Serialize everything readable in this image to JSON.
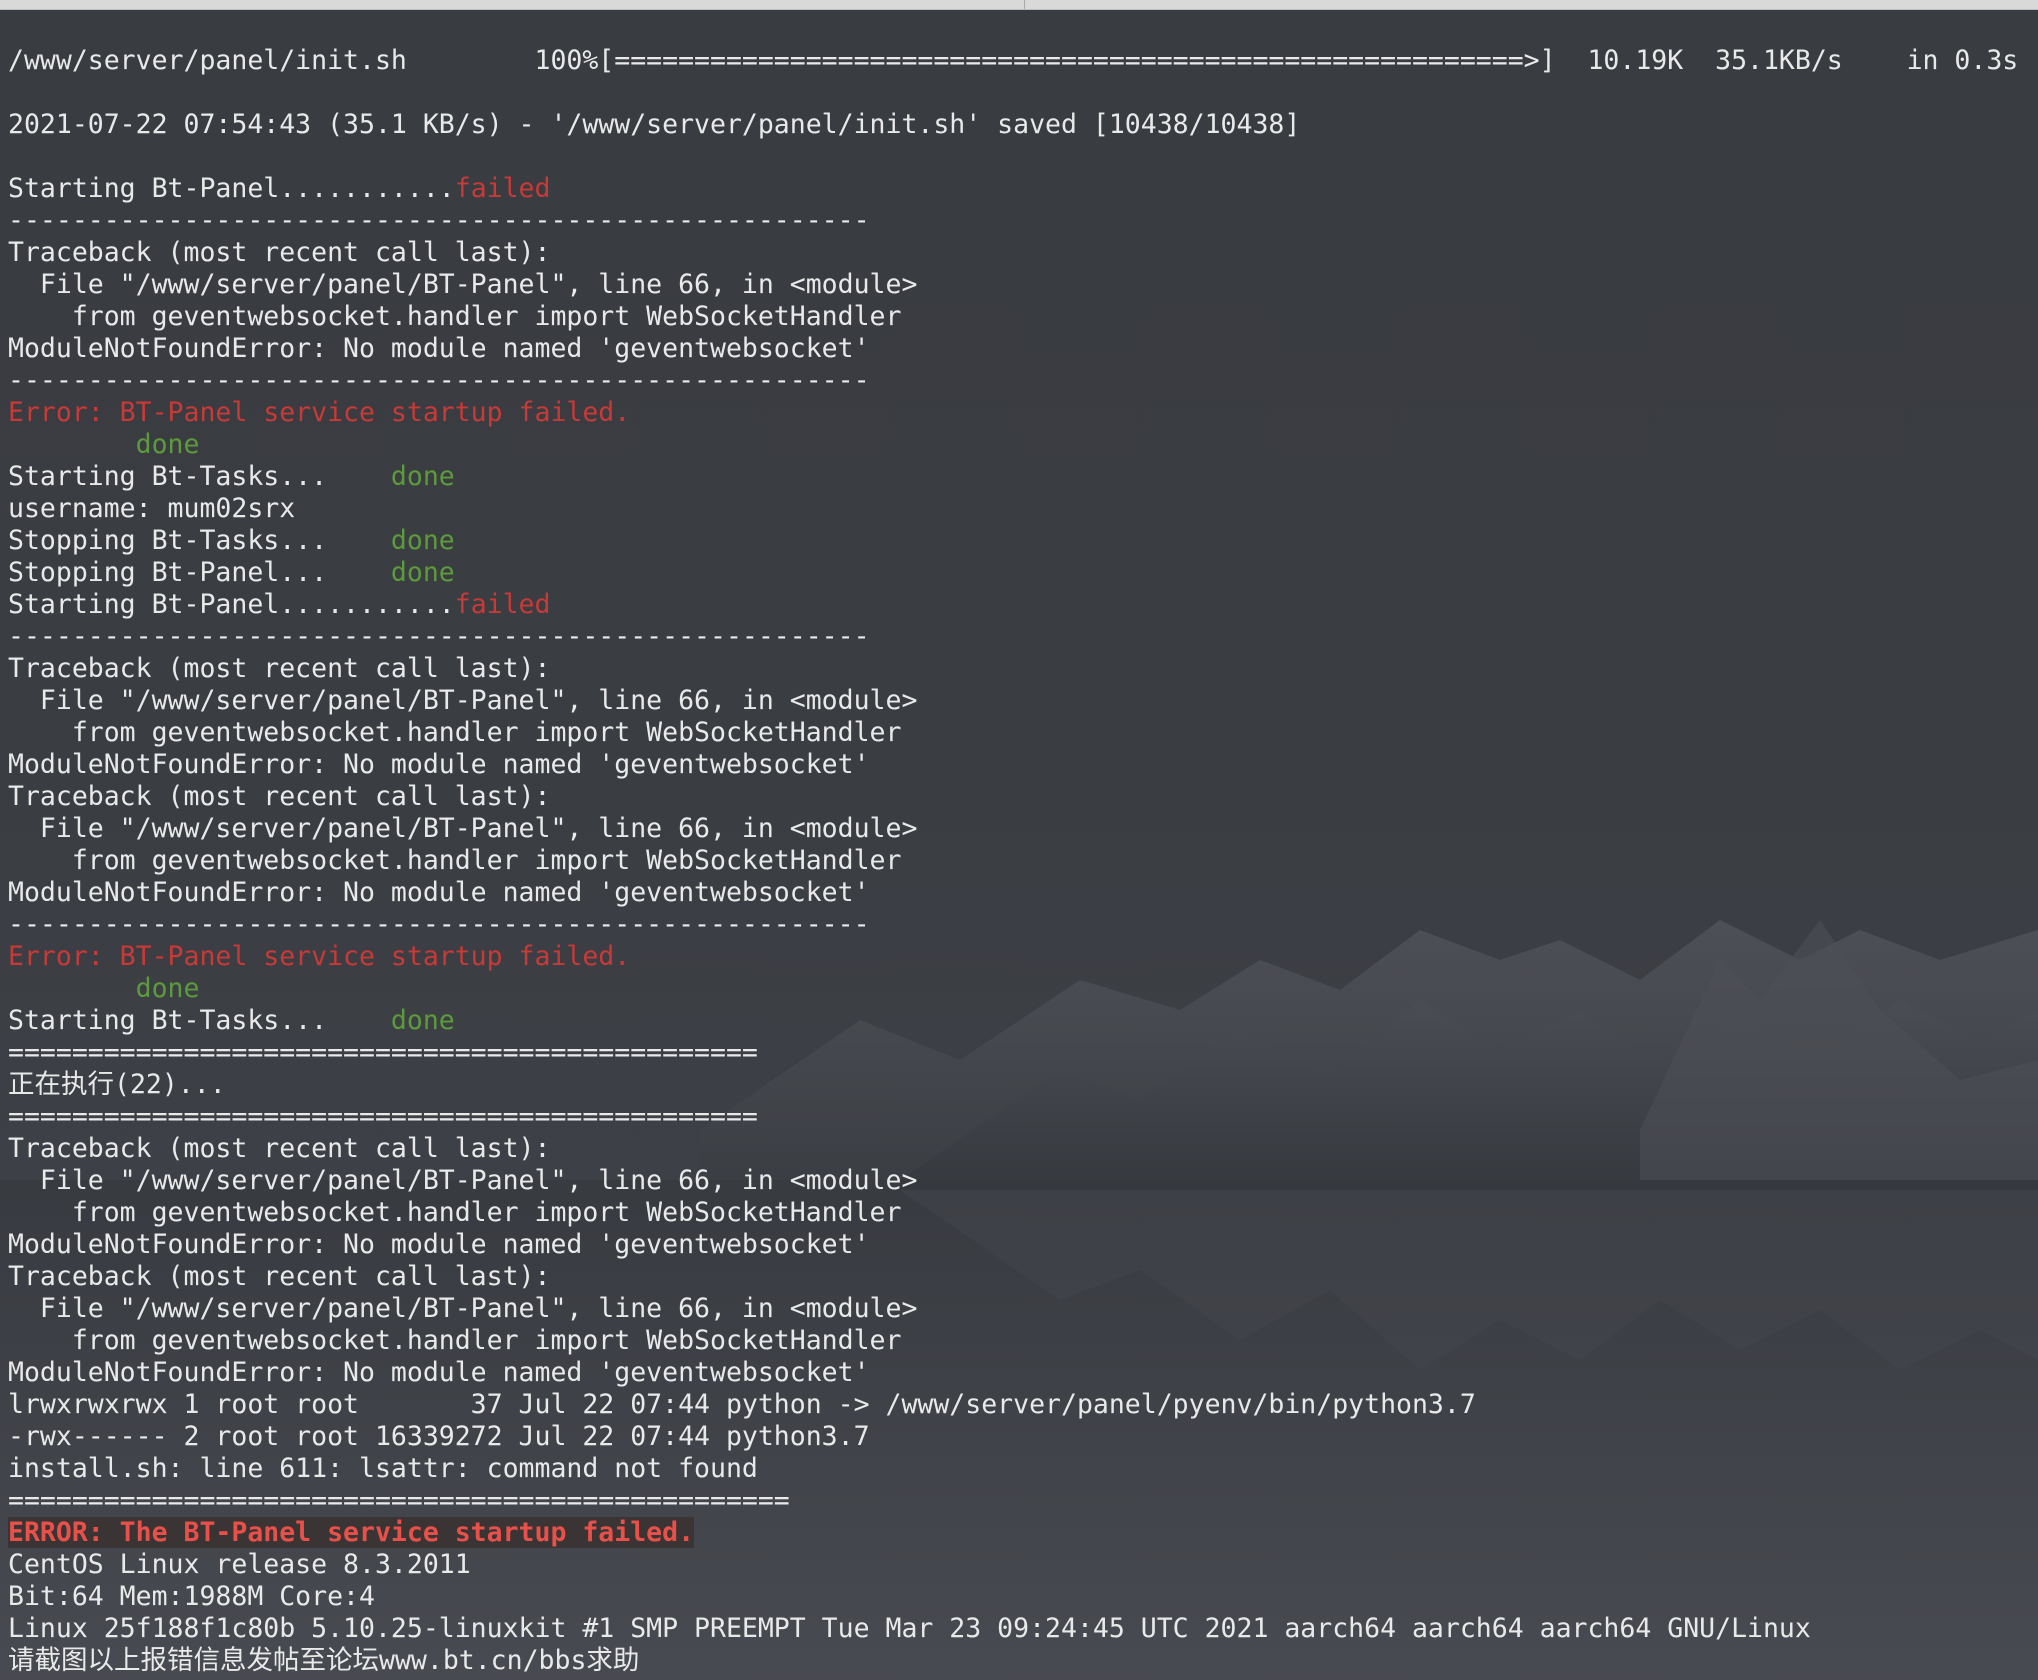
{
  "terminal": {
    "lines": [
      {
        "text": "/www/server/panel/init.sh        100%[=========================================================>]  10.19K  35.1KB/s    in 0.3s"
      },
      {
        "text": ""
      },
      {
        "text": "2021-07-22 07:54:43 (35.1 KB/s) - '/www/server/panel/init.sh' saved [10438/10438]"
      },
      {
        "text": ""
      },
      {
        "text": "Starting Bt-Panel...........",
        "suffix": "failed",
        "suffix_color": "red"
      },
      {
        "text": "------------------------------------------------------"
      },
      {
        "text": "Traceback (most recent call last):"
      },
      {
        "text": "  File \"/www/server/panel/BT-Panel\", line 66, in <module>"
      },
      {
        "text": "    from geventwebsocket.handler import WebSocketHandler"
      },
      {
        "text": "ModuleNotFoundError: No module named 'geventwebsocket'"
      },
      {
        "text": "------------------------------------------------------"
      },
      {
        "text": "Error: BT-Panel service startup failed.",
        "color": "red"
      },
      {
        "text": "        ",
        "suffix": "done",
        "suffix_color": "green"
      },
      {
        "text": "Starting Bt-Tasks...    ",
        "suffix": "done",
        "suffix_color": "green"
      },
      {
        "text": "username: mum02srx"
      },
      {
        "text": "Stopping Bt-Tasks...    ",
        "suffix": "done",
        "suffix_color": "green"
      },
      {
        "text": "Stopping Bt-Panel...    ",
        "suffix": "done",
        "suffix_color": "green"
      },
      {
        "text": "Starting Bt-Panel...........",
        "suffix": "failed",
        "suffix_color": "red"
      },
      {
        "text": "------------------------------------------------------"
      },
      {
        "text": "Traceback (most recent call last):"
      },
      {
        "text": "  File \"/www/server/panel/BT-Panel\", line 66, in <module>"
      },
      {
        "text": "    from geventwebsocket.handler import WebSocketHandler"
      },
      {
        "text": "ModuleNotFoundError: No module named 'geventwebsocket'"
      },
      {
        "text": "Traceback (most recent call last):"
      },
      {
        "text": "  File \"/www/server/panel/BT-Panel\", line 66, in <module>"
      },
      {
        "text": "    from geventwebsocket.handler import WebSocketHandler"
      },
      {
        "text": "ModuleNotFoundError: No module named 'geventwebsocket'"
      },
      {
        "text": "------------------------------------------------------"
      },
      {
        "text": "Error: BT-Panel service startup failed.",
        "color": "red"
      },
      {
        "text": "        ",
        "suffix": "done",
        "suffix_color": "green"
      },
      {
        "text": "Starting Bt-Tasks...    ",
        "suffix": "done",
        "suffix_color": "green"
      },
      {
        "text": "==============================================="
      },
      {
        "text": "正在执行(22)..."
      },
      {
        "text": "==============================================="
      },
      {
        "text": "Traceback (most recent call last):"
      },
      {
        "text": "  File \"/www/server/panel/BT-Panel\", line 66, in <module>"
      },
      {
        "text": "    from geventwebsocket.handler import WebSocketHandler"
      },
      {
        "text": "ModuleNotFoundError: No module named 'geventwebsocket'"
      },
      {
        "text": "Traceback (most recent call last):"
      },
      {
        "text": "  File \"/www/server/panel/BT-Panel\", line 66, in <module>"
      },
      {
        "text": "    from geventwebsocket.handler import WebSocketHandler"
      },
      {
        "text": "ModuleNotFoundError: No module named 'geventwebsocket'"
      },
      {
        "text": "lrwxrwxrwx 1 root root       37 Jul 22 07:44 python -> /www/server/panel/pyenv/bin/python3.7"
      },
      {
        "text": "-rwx------ 2 root root 16339272 Jul 22 07:44 python3.7"
      },
      {
        "text": "install.sh: line 611: lsattr: command not found"
      },
      {
        "text": "================================================="
      },
      {
        "text": "ERROR: The BT-Panel service startup failed.",
        "style": "bold-err"
      },
      {
        "text": "CentOS Linux release 8.3.2011"
      },
      {
        "text": "Bit:64 Mem:1988M Core:4"
      },
      {
        "text": "Linux 25f188f1c80b 5.10.25-linuxkit #1 SMP PREEMPT Tue Mar 23 09:24:45 UTC 2021 aarch64 aarch64 aarch64 GNU/Linux"
      },
      {
        "text": "请截图以上报错信息发帖至论坛www.bt.cn/bbs求助"
      }
    ]
  },
  "colors": {
    "background": "#3b3e43",
    "text": "#e9e9e9",
    "error_red": "#c83a37",
    "done_green": "#5d9a3c",
    "bold_error": "#e8504a"
  }
}
